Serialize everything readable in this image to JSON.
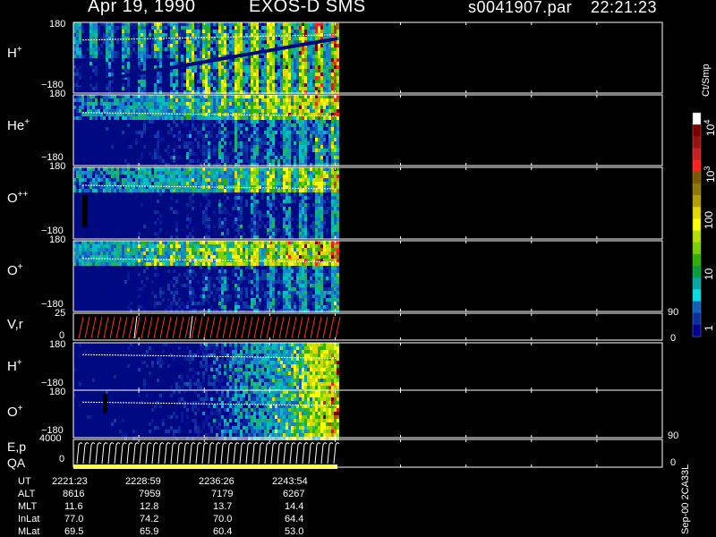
{
  "header": {
    "date": "Apr 19, 1990",
    "instrument": "EXOS-D SMS",
    "file": "s0041907.par",
    "time": "22:21:23"
  },
  "panels": [
    {
      "label_main": "H",
      "label_sup": "+",
      "y_top": "180",
      "y_bottom": "−180",
      "type": "ion"
    },
    {
      "label_main": "He",
      "label_sup": "+",
      "y_top": "180",
      "y_bottom": "−180",
      "type": "ion"
    },
    {
      "label_main": "O",
      "label_sup": "++",
      "y_top": "180",
      "y_bottom": "−180",
      "type": "ion"
    },
    {
      "label_main": "O",
      "label_sup": "+",
      "y_top": "180",
      "y_bottom": "−180",
      "type": "ion"
    },
    {
      "label_main": "V,r",
      "label_sup": "",
      "y_top": "25",
      "y_bottom": "0",
      "right_top": "90",
      "right_bottom": "0",
      "type": "vr"
    },
    {
      "label_main": "H",
      "label_sup": "+",
      "y_top": "180",
      "y_bottom": "−180",
      "type": "ion2"
    },
    {
      "label_main": "O",
      "label_sup": "+",
      "y_top": "180",
      "y_bottom": "−180",
      "type": "ion2"
    },
    {
      "label_main": "E,p",
      "label_sup": "",
      "label_extra": "QA",
      "y_top": "4000",
      "y_bottom": "0",
      "right_top": "90",
      "right_bottom": "0",
      "type": "ep"
    }
  ],
  "colorbar": {
    "unit": "Ct/Smp",
    "labels": [
      {
        "base": "10",
        "exp": "4"
      },
      {
        "base": "10",
        "exp": "3"
      },
      {
        "base": "100",
        "exp": ""
      },
      {
        "base": "10",
        "exp": ""
      },
      {
        "base": "1",
        "exp": ""
      }
    ],
    "colors": [
      "#ffffff",
      "#7a0000",
      "#9b1010",
      "#c82020",
      "#ff2020",
      "#7a5a00",
      "#8f7a00",
      "#b4a000",
      "#e6d800",
      "#ffff00",
      "#b4e000",
      "#7ad000",
      "#30b000",
      "#00a040",
      "#00a8a8",
      "#00e0e0",
      "#1060c0",
      "#0830a0",
      "#000090"
    ]
  },
  "footer": {
    "rows": [
      {
        "label": "UT",
        "values": [
          "2221:23",
          "2228:59",
          "2236:26",
          "2243:54"
        ]
      },
      {
        "label": "ALT",
        "values": [
          "8616",
          "7959",
          "7179",
          "6267"
        ]
      },
      {
        "label": "MLT",
        "values": [
          "11.6",
          "12.8",
          "13.7",
          "14.4"
        ]
      },
      {
        "label": "InLat",
        "values": [
          "77.0",
          "74.2",
          "70.0",
          "64.4"
        ]
      },
      {
        "label": "MLat",
        "values": [
          "69.5",
          "65.9",
          "60.4",
          "53.0"
        ]
      }
    ],
    "side_note": "Sep-00 2CA33L"
  }
}
